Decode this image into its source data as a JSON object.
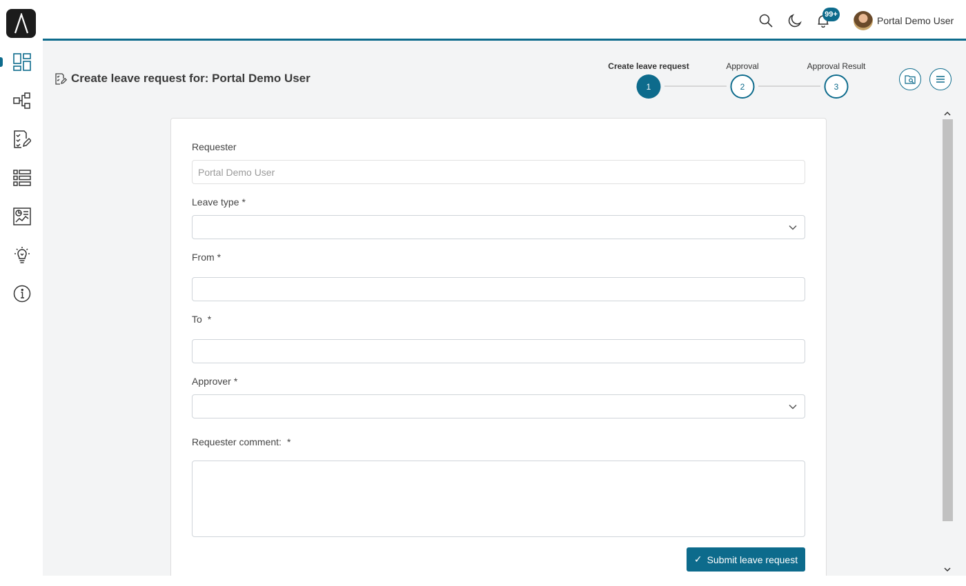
{
  "header": {
    "notification_badge": "99+",
    "user_name": "Portal Demo User",
    "icons": [
      "search-icon",
      "moon-icon",
      "bell-icon"
    ]
  },
  "sidebar": {
    "items": [
      {
        "name": "dashboard",
        "icon": "dashboard-icon",
        "active": true
      },
      {
        "name": "processes",
        "icon": "process-flow-icon"
      },
      {
        "name": "tasks",
        "icon": "task-checklist-icon"
      },
      {
        "name": "cases",
        "icon": "list-icon"
      },
      {
        "name": "statistics",
        "icon": "statistics-icon"
      },
      {
        "name": "demo",
        "icon": "lightbulb-icon"
      },
      {
        "name": "info",
        "icon": "info-icon"
      }
    ]
  },
  "page": {
    "title": "Create leave request for: Portal Demo User",
    "title_icon": "edit-task-icon"
  },
  "stepper": {
    "steps": [
      {
        "label": "Create leave request",
        "number": "1",
        "active": true
      },
      {
        "label": "Approval",
        "number": "2",
        "active": false
      },
      {
        "label": "Approval Result",
        "number": "3",
        "active": false
      }
    ]
  },
  "actions": {
    "icons": [
      "case-details-icon",
      "menu-icon"
    ]
  },
  "form": {
    "requester": {
      "label": "Requester",
      "value": "Portal Demo User"
    },
    "leave_type": {
      "label": "Leave type",
      "required": "*",
      "value": ""
    },
    "from": {
      "label": "From",
      "required": "*",
      "value": ""
    },
    "to": {
      "label": "To",
      "required": "*",
      "value": ""
    },
    "approver": {
      "label": "Approver",
      "required": "*",
      "value": ""
    },
    "comment": {
      "label": "Requester comment:",
      "required": "*",
      "value": ""
    },
    "submit_label": "Submit leave request"
  },
  "colors": {
    "accent": "#0d6b8c",
    "background": "#f3f4f5"
  }
}
